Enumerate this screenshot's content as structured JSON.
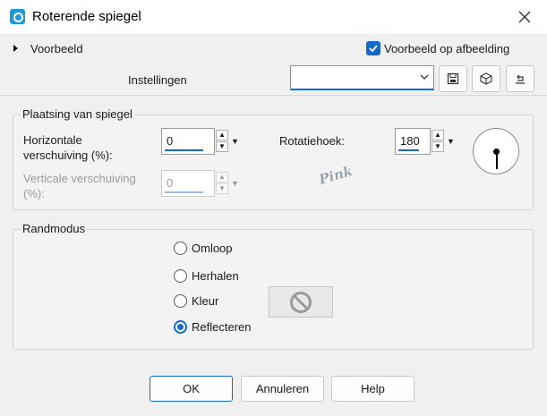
{
  "window": {
    "title": "Roterende spiegel"
  },
  "preview": {
    "label": "Voorbeeld",
    "checkbox_label": "Voorbeeld op afbeelding",
    "checked": true
  },
  "settings": {
    "label": "Instellingen",
    "combo_value": ""
  },
  "placement": {
    "title": "Plaatsing van spiegel",
    "horizontal_label_line1": "Horizontale",
    "horizontal_label_line2": "verschuiving (%):",
    "horizontal_value": "0",
    "vertical_label_line1": "Verticale verschuiving",
    "vertical_label_line2": "(%):",
    "vertical_value": "0",
    "rotation_label": "Rotatiehoek:",
    "rotation_value": "180"
  },
  "watermark": "Pink",
  "edge_mode": {
    "title": "Randmodus",
    "options": [
      "Omloop",
      "Herhalen",
      "Kleur",
      "Reflecteren"
    ],
    "selected": "Reflecteren"
  },
  "buttons": {
    "ok": "OK",
    "cancel": "Annuleren",
    "help": "Help"
  },
  "colors": {
    "accent": "#1569c7",
    "title_icon": "#1c9ad6"
  }
}
